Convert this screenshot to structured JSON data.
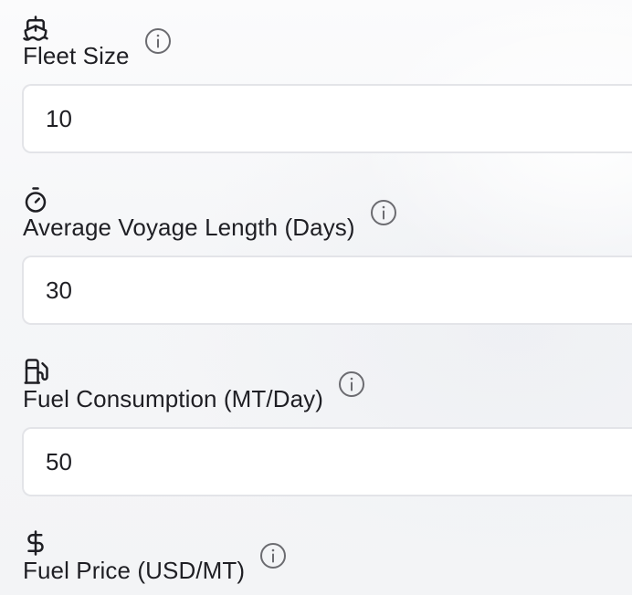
{
  "fields": [
    {
      "label": "Fleet Size",
      "value": "10",
      "icon": "ship-icon"
    },
    {
      "label": "Average Voyage Length (Days)",
      "value": "30",
      "icon": "stopwatch-icon"
    },
    {
      "label": "Fuel Consumption (MT/Day)",
      "value": "50",
      "icon": "fuel-pump-icon"
    },
    {
      "label": "Fuel Price (USD/MT)",
      "value": "",
      "icon": "dollar-icon"
    }
  ],
  "info_icon": "info-icon",
  "colors": {
    "text": "#1f1f24",
    "input_border": "#e3e4e8",
    "input_bg": "#ffffff",
    "icon_gray": "#6b6b70"
  }
}
